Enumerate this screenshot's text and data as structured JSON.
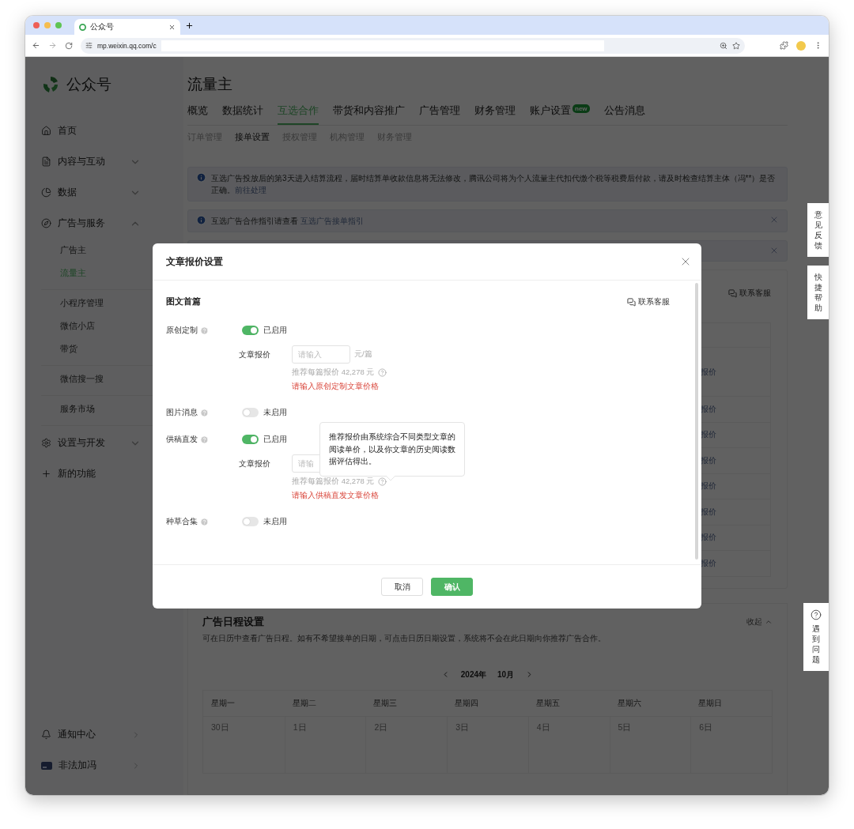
{
  "browser": {
    "tab_title": "公众号",
    "url": "mp.weixin.qq.com/c"
  },
  "sidebar": {
    "logo": "公众号",
    "items": [
      {
        "label": "首页"
      },
      {
        "label": "内容与互动",
        "expanded": false
      },
      {
        "label": "数据",
        "expanded": false
      },
      {
        "label": "广告与服务",
        "expanded": true,
        "groups": [
          {
            "children": [
              {
                "label": "广告主",
                "selected": false
              },
              {
                "label": "流量主",
                "selected": true
              }
            ]
          },
          {
            "children": [
              {
                "label": "小程序管理",
                "selected": false
              },
              {
                "label": "微信小店",
                "selected": false
              },
              {
                "label": "带货",
                "selected": false
              }
            ]
          },
          {
            "children": [
              {
                "label": "微信搜一搜",
                "selected": false
              }
            ]
          },
          {
            "children": [
              {
                "label": "服务市场",
                "selected": false
              }
            ]
          }
        ]
      },
      {
        "label": "设置与开发",
        "expanded": false
      },
      {
        "label": "新的功能"
      }
    ],
    "bottom": [
      {
        "label": "通知中心"
      },
      {
        "label": "非法加冯"
      }
    ]
  },
  "page": {
    "title": "流量主",
    "tabs": [
      {
        "label": "概览",
        "selected": false
      },
      {
        "label": "数据统计",
        "selected": false
      },
      {
        "label": "互选合作",
        "selected": true
      },
      {
        "label": "带货和内容推广",
        "selected": false
      },
      {
        "label": "广告管理",
        "selected": false
      },
      {
        "label": "财务管理",
        "selected": false
      },
      {
        "label": "账户设置",
        "selected": false,
        "badge": "new"
      },
      {
        "label": "公告消息",
        "selected": false
      }
    ],
    "subtabs": [
      {
        "label": "订单管理",
        "selected": false
      },
      {
        "label": "接单设置",
        "selected": true
      },
      {
        "label": "授权管理",
        "selected": false
      },
      {
        "label": "机构管理",
        "selected": false
      },
      {
        "label": "财务管理",
        "selected": false
      }
    ],
    "alerts": [
      {
        "text": "互选广告投放后的第3天进入结算流程，届时结算单收款信息将无法修改，腾讯公司将为个人流量主代扣代缴个税等税费后付款，请及时检查结算主体（冯**）是否正确。",
        "link": "前往处理",
        "closable": false
      },
      {
        "text": "互选广告合作指引请查看",
        "link": "互选广告接单指引",
        "closable": true
      },
      {
        "closable": true
      }
    ],
    "card": {
      "contact": "联系客服",
      "rows": [
        "报价",
        "报价",
        "报价",
        "报价",
        "报价",
        "报价",
        "报价",
        "报价"
      ]
    },
    "schedule": {
      "title": "广告日程设置",
      "description": "可在日历中查看广告日程。如有不希望接单的日期，可点击日历日期设置，系统将不会在此日期向你推荐广告合作。",
      "collapse": "收起",
      "year": "2024年",
      "month": "10月",
      "weekdays": [
        "星期一",
        "星期二",
        "星期三",
        "星期四",
        "星期五",
        "星期六",
        "星期日"
      ],
      "days": [
        "30日",
        "1日",
        "2日",
        "3日",
        "4日",
        "5日",
        "6日"
      ]
    }
  },
  "modal": {
    "title": "文章报价设置",
    "section": "图文首篇",
    "contact": "联系客服",
    "rows": [
      {
        "label": "原创定制",
        "on": true,
        "status": "已启用",
        "price": {
          "label": "文章报价",
          "placeholder": "请输入",
          "unit": "元/篇",
          "hint": "推荐每篇报价 42,278 元",
          "error": "请输入原创定制文章价格"
        }
      },
      {
        "label": "图片消息",
        "on": false,
        "status": "未启用"
      },
      {
        "label": "供稿直发",
        "on": true,
        "status": "已启用",
        "price": {
          "label": "文章报价",
          "placeholder": "请输",
          "hint": "推荐每篇报价 42,278 元",
          "error": "请输入供稿直发文章价格"
        }
      },
      {
        "label": "种草合集",
        "on": false,
        "status": "未启用"
      }
    ],
    "tooltip": "推荐报价由系统综合不同类型文章的阅读单价，以及你文章的历史阅读数据评估得出。",
    "cancel": "取消",
    "confirm": "确认"
  },
  "side_buttons": [
    "意见反馈",
    "快捷帮助"
  ],
  "help_button": "遇到问题"
}
